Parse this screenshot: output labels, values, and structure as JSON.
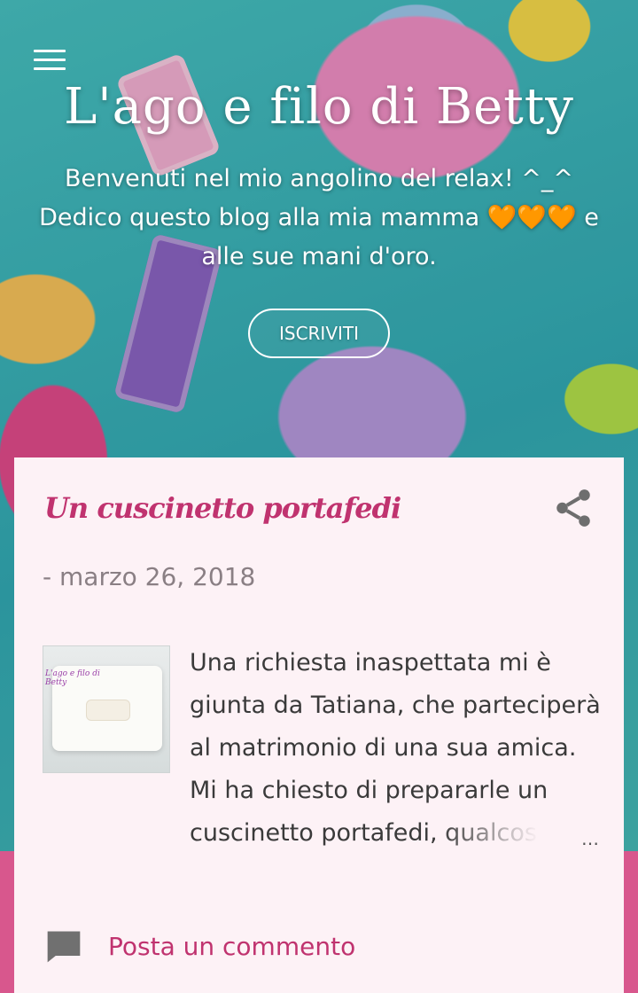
{
  "header": {
    "title": "L'ago e filo di Betty",
    "description": "Benvenuti nel mio angolino del relax! ^_^ Dedico questo blog alla mia mamma 🧡🧡🧡 e alle sue mani d'oro.",
    "subscribe_label": "ISCRIVITI",
    "menu_icon": "hamburger-menu-icon"
  },
  "post": {
    "title": "Un cuscinetto portafedi",
    "date": "- marzo 26, 2018",
    "snippet": "Una richiesta inaspettata mi è giunta da Tatiana, che parteciperà al matrimonio di una sua amica. Mi ha chiesto di prepararle un cuscinetto portafedi, qualcosa c",
    "ellipsis": "…",
    "thumbnail_caption": "L'ago e filo di Betty",
    "share_icon": "share-icon",
    "comment_label": "Posta un commento",
    "comment_icon": "comment-icon"
  },
  "colors": {
    "accent": "#c0336f",
    "card_bg": "#fdf2f6",
    "band": "#d8578d"
  }
}
